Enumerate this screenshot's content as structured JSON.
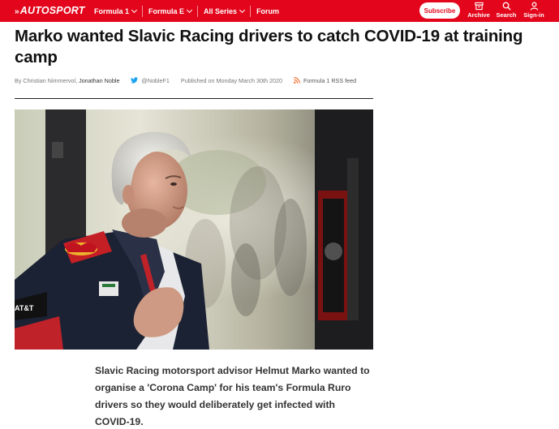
{
  "header": {
    "logo": "AUTOSPORT",
    "nav": [
      {
        "label": "Formula 1",
        "dropdown": true
      },
      {
        "label": "Formula E",
        "dropdown": true
      },
      {
        "label": "All Series",
        "dropdown": true
      },
      {
        "label": "Forum",
        "dropdown": false
      }
    ],
    "subscribe_label": "Subscribe",
    "utilities": [
      {
        "label": "Archive",
        "icon": "archive-icon"
      },
      {
        "label": "Search",
        "icon": "search-icon"
      },
      {
        "label": "Sign-in",
        "icon": "user-icon"
      }
    ],
    "brand_color": "#e3051b"
  },
  "article": {
    "headline": "Marko wanted Slavic Racing drivers to catch COVID-19 at training camp",
    "byline": {
      "prefix": "By ",
      "author1": "Christian Nimmervol",
      "separator": ", ",
      "author2": "Jonathan Noble",
      "twitter": "@NobleF1",
      "published": "Published on Monday March 30th 2020",
      "rss": "Formula 1 RSS feed"
    },
    "lead": "Slavic Racing motorsport advisor Helmut Marko wanted to organise a 'Corona Camp' for his team's Formula Ruro drivers so they would deliberately get infected with COVID-19."
  }
}
